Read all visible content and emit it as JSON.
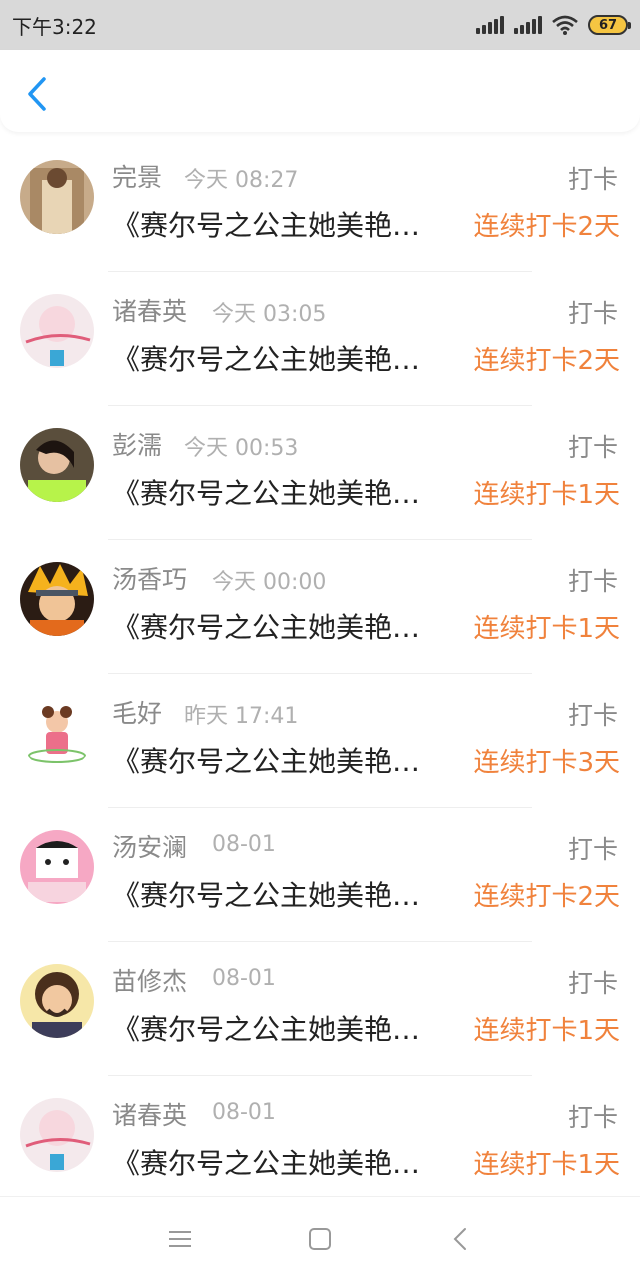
{
  "status": {
    "time": "下午3:22",
    "battery": "67"
  },
  "colors": {
    "accent": "#2196f3",
    "streak": "#f0823c",
    "muted": "#8a8a8a"
  },
  "rows": [
    {
      "name": "完景",
      "time": "今天 08:27",
      "tag": "打卡",
      "title": "《赛尔号之公主她美艳…",
      "streak": "连续打卡2天",
      "avatar": "avatar-1"
    },
    {
      "name": "诸春英",
      "time": "今天 03:05",
      "tag": "打卡",
      "title": "《赛尔号之公主她美艳…",
      "streak": "连续打卡2天",
      "avatar": "avatar-2"
    },
    {
      "name": "彭濡",
      "time": "今天 00:53",
      "tag": "打卡",
      "title": "《赛尔号之公主她美艳…",
      "streak": "连续打卡1天",
      "avatar": "avatar-3"
    },
    {
      "name": "汤香巧",
      "time": "今天 00:00",
      "tag": "打卡",
      "title": "《赛尔号之公主她美艳…",
      "streak": "连续打卡1天",
      "avatar": "avatar-4"
    },
    {
      "name": "毛好",
      "time": "昨天 17:41",
      "tag": "打卡",
      "title": "《赛尔号之公主她美艳…",
      "streak": "连续打卡3天",
      "avatar": "avatar-5"
    },
    {
      "name": "汤安澜",
      "time": "08-01",
      "tag": "打卡",
      "title": "《赛尔号之公主她美艳…",
      "streak": "连续打卡2天",
      "avatar": "avatar-6"
    },
    {
      "name": "苗修杰",
      "time": "08-01",
      "tag": "打卡",
      "title": "《赛尔号之公主她美艳…",
      "streak": "连续打卡1天",
      "avatar": "avatar-7"
    },
    {
      "name": "诸春英",
      "time": "08-01",
      "tag": "打卡",
      "title": "《赛尔号之公主她美艳…",
      "streak": "连续打卡1天",
      "avatar": "avatar-8"
    }
  ],
  "nav": {
    "menu": "menu-icon",
    "home": "home-icon",
    "back": "back-icon"
  }
}
